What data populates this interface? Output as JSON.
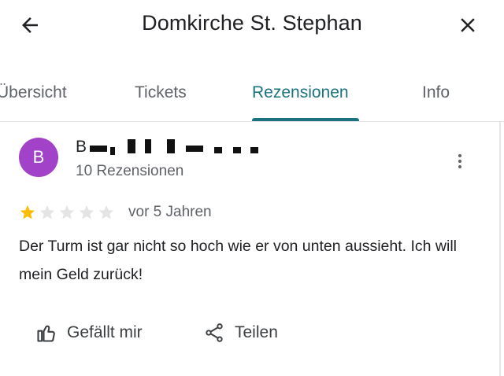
{
  "header": {
    "title": "Domkirche St. Stephan",
    "back_icon": "arrow-left-icon",
    "close_icon": "close-icon"
  },
  "tabs": [
    {
      "label": "Übersicht",
      "active": false
    },
    {
      "label": "Tickets",
      "active": false
    },
    {
      "label": "Rezensionen",
      "active": true
    },
    {
      "label": "Info",
      "active": false
    }
  ],
  "review": {
    "avatar_initial": "B",
    "reviewer_name_visible": "B",
    "reviewer_meta": "10 Rezensionen",
    "rating": 1,
    "max_rating": 5,
    "date": "vor 5 Jahren",
    "text": "Der Turm ist gar nicht so hoch wie er von unten aussieht. Ich will mein Geld zurück!",
    "more_icon": "more-vertical-icon"
  },
  "actions": {
    "like_label": "Gefällt mir",
    "like_icon": "thumbs-up-icon",
    "share_label": "Teilen",
    "share_icon": "share-icon"
  },
  "colors": {
    "accent": "#1a737e",
    "avatar": "#a142c9",
    "star_filled": "#fbbc04",
    "star_empty": "#e0e0e0",
    "text_primary": "#202124",
    "text_secondary": "#5f6368"
  }
}
